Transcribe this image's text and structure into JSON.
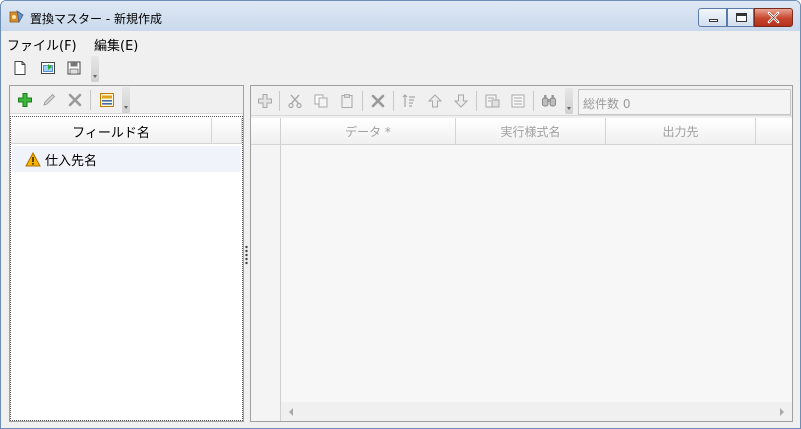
{
  "window": {
    "title": "置換マスター - 新規作成"
  },
  "menu": {
    "items": [
      {
        "label": "ファイル(F)"
      },
      {
        "label": "編集(E)"
      }
    ]
  },
  "main_toolbar": {
    "icons": [
      "new-file-icon",
      "open-file-icon",
      "save-icon"
    ]
  },
  "left_panel": {
    "toolbar_icons": [
      "add-icon",
      "edit-icon",
      "delete-icon",
      "calculator-icon"
    ],
    "columns": [
      "フィールド名",
      ""
    ],
    "rows": [
      {
        "label": "仕入先名",
        "icon": "warning-icon"
      }
    ]
  },
  "right_panel": {
    "toolbar_icons": [
      "add-row-icon",
      "cut-icon",
      "copy-icon",
      "paste-icon",
      "delete-row-icon",
      "sort-icon",
      "move-up-icon",
      "move-down-icon",
      "export-icon",
      "list-icon",
      "find-icon"
    ],
    "count_label": "総件数 0",
    "columns": [
      "データ *",
      "実行様式名",
      "出力先",
      ""
    ]
  },
  "colors": {
    "accent_add": "#2ea82e",
    "warning": "#f0a000",
    "disabled_text": "#a0a0a0"
  }
}
